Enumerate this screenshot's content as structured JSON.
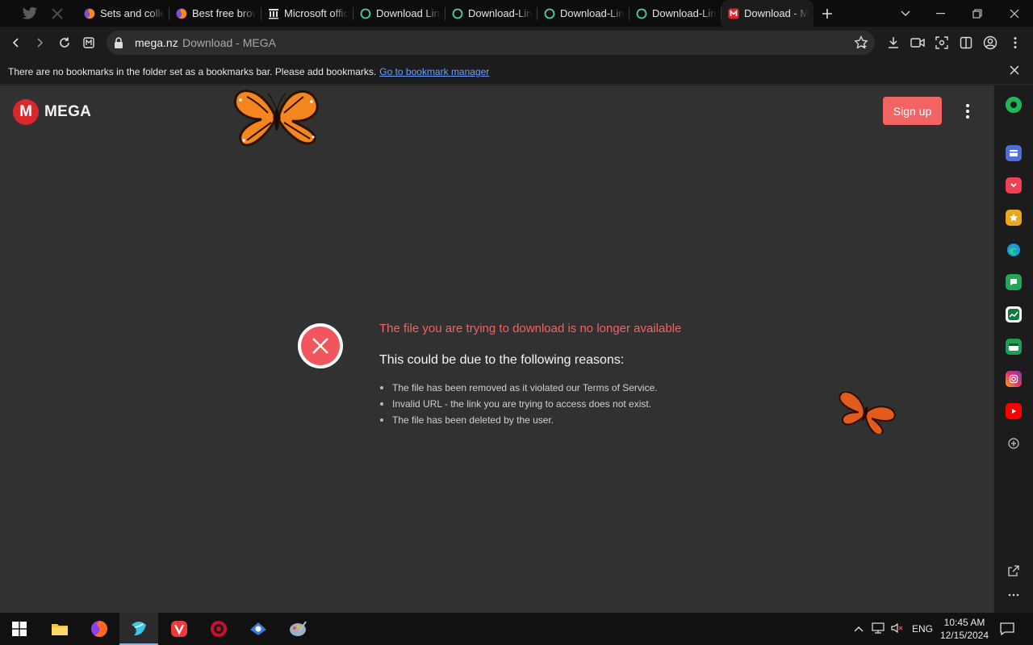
{
  "browser": {
    "tabs": [
      {
        "title": "Sets and collections",
        "favicon": "firefox-icon"
      },
      {
        "title": "Best free browser",
        "favicon": "firefox-icon"
      },
      {
        "title": "Microsoft official",
        "favicon": "building-icon"
      },
      {
        "title": "Download Link",
        "favicon": "circle-icon"
      },
      {
        "title": "Download-Link",
        "favicon": "circle-icon"
      },
      {
        "title": "Download-Link",
        "favicon": "circle-icon"
      },
      {
        "title": "Download-Link",
        "favicon": "circle-icon"
      },
      {
        "title": "Download - MEGA",
        "favicon": "mega-icon",
        "active": true
      }
    ],
    "omnibox": {
      "host": "mega.nz",
      "page_title": "Download - MEGA"
    },
    "bookmarks_notice": {
      "message": "There are no bookmarks in the folder set as a bookmarks bar. Please add bookmarks.",
      "link": "Go to bookmark manager"
    }
  },
  "page": {
    "logo_letter": "M",
    "logo_text": "MEGA",
    "signup_label": "Sign up",
    "error": {
      "title": "The file you are trying to download is no longer available",
      "subtitle": "This could be due to the following reasons:",
      "reasons": [
        "The file has been removed as it violated our Terms of Service.",
        "Invalid URL - the link you are trying to access does not exist.",
        "The file has been deleted by the user."
      ]
    }
  },
  "taskbar": {
    "language": "ENG",
    "time": "10:45 AM",
    "date": "12/15/2024"
  },
  "colors": {
    "mega_red": "#d9272e",
    "signup": "#f26363",
    "error_text": "#f26363",
    "link": "#6aa0ff"
  }
}
